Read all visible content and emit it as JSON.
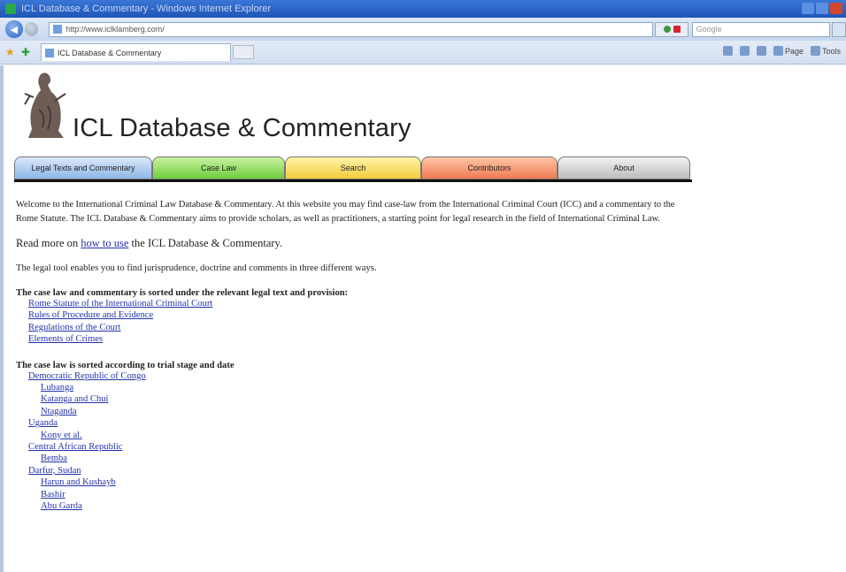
{
  "browser": {
    "window_title": "ICL Database & Commentary - Windows Internet Explorer",
    "address_url": "http://www.iclklamberg.com/",
    "search_placeholder": "Google",
    "tab_title": "ICL Database & Commentary",
    "commands": {
      "page": "Page",
      "tools": "Tools"
    }
  },
  "site": {
    "title": "ICL Database & Commentary",
    "nav_tabs": [
      "Legal Texts and Commentary",
      "Case Law",
      "Search",
      "Contributors",
      "About"
    ]
  },
  "content": {
    "intro": "Welcome to the International Criminal Law Database & Commentary. At this website you may find case-law from the International Criminal Court (ICC) and a commentary to the Rome Statute. The ICL Database & Commentary aims to provide scholars, as well as practitioners, a starting point for legal research in the field of International Criminal Law.",
    "read_more_prefix": "Read more on",
    "read_more_link": "how to use",
    "read_more_suffix": "the ICL Database & Commentary.",
    "tool_note": "The legal tool enables you to find jurisprudence, doctrine and comments in three different ways.",
    "section1_heading": "The case law and commentary is sorted under the relevant legal text and provision:",
    "section1_links": [
      "Rome Statute of the International Criminal Court",
      "Rules of Procedure and Evidence",
      "Regulations of the Court",
      "Elements of Crimes"
    ],
    "section2_heading": "The case law is sorted according to trial stage and date",
    "situations": {
      "drc": "Democratic Republic of Congo",
      "drc_cases": [
        "Lubanga",
        "Katanga and Chui",
        "Ntaganda"
      ],
      "uganda": "Uganda",
      "uganda_cases": [
        "Kony et al."
      ],
      "car": "Central African Republic",
      "car_cases": [
        "Bemba"
      ],
      "darfur": "Darfur, Sudan",
      "darfur_cases": [
        "Harun and Kushayb",
        "Bashir",
        "Abu Garda"
      ]
    }
  }
}
